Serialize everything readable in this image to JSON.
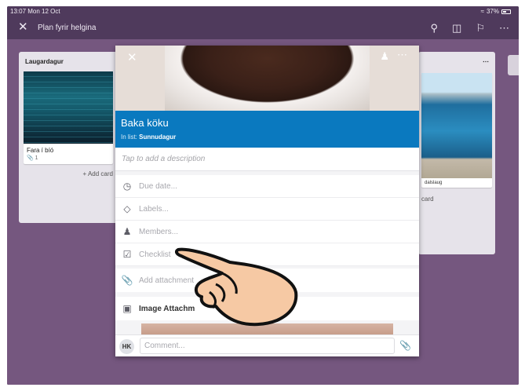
{
  "status": {
    "time": "13:07  Mon 12 Oct",
    "battery": "37%"
  },
  "topbar": {
    "board_title": "Plan fyrir helgina"
  },
  "lists": {
    "left": {
      "title": "Laugardagur",
      "card_title": "Fara í bíó",
      "attachments": "1",
      "add_card": "+ Add card"
    },
    "right": {
      "card_title": "dalslaug",
      "add_card": "card"
    }
  },
  "card": {
    "name": "Baka köku",
    "in_list_label": "In list:",
    "list_name": "Sunnudagur",
    "description_placeholder": "Tap to add a description",
    "rows": [
      {
        "icon": "clock-icon",
        "label": "Due date..."
      },
      {
        "icon": "tag-icon",
        "label": "Labels..."
      },
      {
        "icon": "person-icon",
        "label": "Members..."
      },
      {
        "icon": "checklist-icon",
        "label": "Checklist"
      }
    ],
    "add_attachment": "Add attachment",
    "image_attachments": "Image Attachm",
    "comment": {
      "avatar": "HK",
      "placeholder": "Comment..."
    }
  },
  "colors": {
    "board": "#75577f",
    "title_band": "#0a79bf"
  }
}
